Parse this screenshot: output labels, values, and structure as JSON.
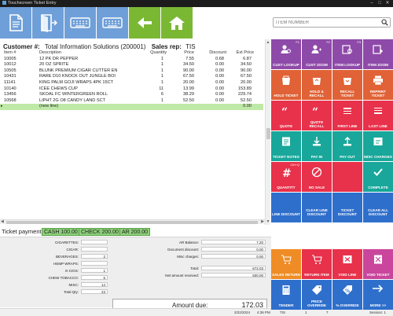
{
  "window": {
    "title": "Touchscreen Ticket Entry",
    "min": "–",
    "max": "□",
    "close": "✕"
  },
  "search": {
    "placeholder": "ITEM NUMBER"
  },
  "customer": {
    "label": "Customer #:",
    "value": "Total Information Solutions (200001)",
    "salesrep_label": "Sales rep:",
    "salesrep_value": "TIS"
  },
  "grid": {
    "headers": {
      "item": "Item #",
      "description": "Description",
      "quantity": "Quantity",
      "price": "Price",
      "discount": "Discount",
      "ext_price": "Ext Price"
    },
    "rows": [
      {
        "item": "10005",
        "description": "12 PK DR PEPPER",
        "quantity": "1",
        "price": "7.55",
        "discount": "0.68",
        "ext": "6.87"
      },
      {
        "item": "10012",
        "description": "20 OZ SPRITE",
        "quantity": "1",
        "price": "34.50",
        "discount": "0.00",
        "ext": "34.50"
      },
      {
        "item": "10505",
        "description": "BLUNK PREMIUM CIGAR CUTTER EN",
        "quantity": "1",
        "price": "90.00",
        "discount": "0.00",
        "ext": "90.00"
      },
      {
        "item": "10431",
        "description": "RARE D10 KNOCK OUT JUNGLE BOI",
        "quantity": "1",
        "price": "67.50",
        "discount": "0.00",
        "ext": "67.50"
      },
      {
        "item": "11141",
        "description": "KING PALM GOJI WRAPS 4PK 15CT",
        "quantity": "1",
        "price": "20.00",
        "discount": "0.00",
        "ext": "20.00"
      },
      {
        "item": "10140",
        "description": "ICEE CHEWS CUP",
        "quantity": "11",
        "price": "13.99",
        "discount": "0.00",
        "ext": "153.89"
      },
      {
        "item": "13456",
        "description": "SKOAL FC WINTERGREEN ROLL",
        "quantity": "6",
        "price": "38.29",
        "discount": "0.00",
        "ext": "229.74"
      },
      {
        "item": "10568",
        "description": "LIPHT 2G O8 CANDY LAND SCT",
        "quantity": "1",
        "price": "52.50",
        "discount": "0.00",
        "ext": "52.50"
      }
    ],
    "new_line": {
      "arrow": "▸",
      "description": "(new line)",
      "ext": "0.00"
    }
  },
  "payment": {
    "label": "Ticket payment:",
    "chips": [
      "CASH 100.00",
      "CHECK 200.00",
      "AR 200.00"
    ]
  },
  "totals": {
    "left": [
      {
        "label": "CIGARETTES:",
        "value": ""
      },
      {
        "label": "CIGAR:",
        "value": ""
      },
      {
        "label": "BEVERAGES:",
        "value": "2"
      },
      {
        "label": "HEMP WRAPS:",
        "value": ""
      },
      {
        "label": "E-CIGS:",
        "value": "1"
      },
      {
        "label": "CHEW TOBACCO:",
        "value": "6"
      },
      {
        "label": "MISC:",
        "value": "14"
      }
    ],
    "total_qty": {
      "label": "Total Qty:",
      "value": "23"
    },
    "right_top": [
      {
        "label": "AR Balance:",
        "value": "7.20"
      },
      {
        "label": "Document discount:",
        "value": "0.00"
      },
      {
        "label": "Misc charges:",
        "value": "0.00"
      }
    ],
    "right_bottom": [
      {
        "label": "Total:",
        "value": "672.03"
      },
      {
        "label": "Net amount received:",
        "value": "500.00"
      }
    ],
    "amount_due": {
      "label": "Amount due:",
      "value": "172.03"
    }
  },
  "status": {
    "date": "2/22/2024",
    "time": "4:36 PM",
    "store": "TIS",
    "one": "1",
    "register": "7",
    "session": "Session: 1"
  },
  "buttons": [
    {
      "label": "CUST LOOKUP",
      "key": "F1",
      "icon": "person-search-icon",
      "color": "#8e4aa8"
    },
    {
      "label": "CUST ZOOM",
      "key": "F2",
      "icon": "person-zoom-icon",
      "color": "#8e4aa8"
    },
    {
      "label": "ITEM LOOKUP",
      "key": "F3",
      "icon": "item-lookup-icon",
      "color": "#8e4aa8"
    },
    {
      "label": "ITEM ZOOM",
      "key": "",
      "icon": "item-zoom-icon",
      "color": "#8e4aa8"
    },
    {
      "label": "HOLD TICKET",
      "key": "",
      "icon": "hold-ticket-icon",
      "color": "#e06236"
    },
    {
      "label": "HOLD & RECALL",
      "key": "",
      "icon": "hold-recall-icon",
      "color": "#e06236"
    },
    {
      "label": "RECALL TICKET",
      "key": "",
      "icon": "recall-ticket-icon",
      "color": "#e06236"
    },
    {
      "label": "REPRINT TICKET",
      "key": "",
      "icon": "printer-icon",
      "color": "#e06236"
    },
    {
      "label": "QUOTE",
      "key": "",
      "icon": "quote-icon",
      "color": "#e8314a"
    },
    {
      "label": "QUOTE RECALL",
      "key": "",
      "icon": "quote-recall-icon",
      "color": "#e8314a"
    },
    {
      "label": "FIRST LINE",
      "key": "",
      "icon": "first-line-icon",
      "color": "#e8314a"
    },
    {
      "label": "LAST LINE",
      "key": "",
      "icon": "last-line-icon",
      "color": "#e8314a"
    },
    {
      "label": "TICKET NOTES",
      "key": "",
      "icon": "notes-icon",
      "color": "#18a79a"
    },
    {
      "label": "PAY IN",
      "key": "",
      "icon": "pay-in-icon",
      "color": "#18a79a"
    },
    {
      "label": "PAY OUT",
      "key": "",
      "icon": "pay-out-icon",
      "color": "#18a79a"
    },
    {
      "label": "MISC CHARGES",
      "key": "",
      "icon": "misc-charges-icon",
      "color": "#18a79a"
    },
    {
      "label": "QUANTITY",
      "key": "Ctrl+Q",
      "icon": "hash-icon",
      "color": "#e8314a"
    },
    {
      "label": "NO SALE",
      "key": "",
      "icon": "no-sale-icon",
      "color": "#e8314a"
    },
    {
      "label": "",
      "key": "",
      "icon": "",
      "color": "#e8314a"
    },
    {
      "label": "COMPLETE",
      "key": "",
      "icon": "check-icon",
      "color": "#18a79a"
    },
    {
      "label": "LINE DISCOUNT",
      "key": "",
      "icon": "",
      "color": "#2f6fcc"
    },
    {
      "label": "CLEAR LINE DISCOUNT",
      "key": "",
      "icon": "",
      "color": "#2f6fcc"
    },
    {
      "label": "TICKET DISCOUNT",
      "key": "",
      "icon": "",
      "color": "#2f6fcc"
    },
    {
      "label": "CLEAR ALL DISCOUNT",
      "key": "",
      "icon": "",
      "color": "#2f6fcc"
    },
    {
      "label": "SALES RETURN",
      "key": "",
      "icon": "cart-return-icon",
      "color": "#ef8c25"
    },
    {
      "label": "RETURN ITEM",
      "key": "",
      "icon": "cart-return-item-icon",
      "color": "#e8314a"
    },
    {
      "label": "VOID LINE",
      "key": "",
      "icon": "void-line-icon",
      "color": "#e8314a"
    },
    {
      "label": "VOID TICKET",
      "key": "",
      "icon": "void-ticket-icon",
      "color": "#c9469c"
    },
    {
      "label": "TENDER",
      "key": "",
      "icon": "calculator-icon",
      "color": "#2f6fcc"
    },
    {
      "label": "PRICE OVERRIDE",
      "key": "",
      "icon": "price-tag-icon",
      "color": "#2f6fcc"
    },
    {
      "label": "% OVERRIDE",
      "key": "",
      "icon": "percent-tag-icon",
      "color": "#2f6fcc"
    },
    {
      "label": "MORE >>",
      "key": "",
      "icon": "more-arrow-icon",
      "color": "#2f6fcc"
    }
  ]
}
